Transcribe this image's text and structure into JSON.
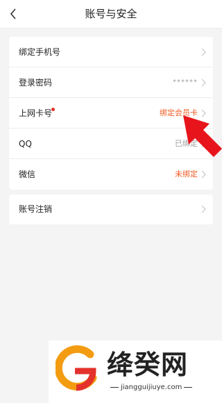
{
  "header": {
    "title": "账号与安全",
    "back_icon": "chevron-left-icon"
  },
  "settings": {
    "rows": [
      {
        "label": "绑定手机号",
        "value": "",
        "dot": false,
        "accent": false
      },
      {
        "label": "登录密码",
        "value": "******",
        "dot": false,
        "accent": false
      },
      {
        "label": "上网卡号",
        "value": "绑定会员卡",
        "dot": true,
        "accent": true
      },
      {
        "label": "QQ",
        "value": "已绑定",
        "dot": false,
        "accent": false
      },
      {
        "label": "微信",
        "value": "未绑定",
        "dot": false,
        "accent": true
      }
    ]
  },
  "account": {
    "cancel_label": "账号注销"
  },
  "annotation": {
    "arrow_icon": "red-arrow-icon",
    "arrow_color": "#e8141c"
  },
  "watermark": {
    "name": "绛癸网",
    "domain": "jiangguijiuye.com"
  },
  "colors": {
    "accent": "#f05a22",
    "notification_dot": "#e0312b",
    "background": "#f4f4f4"
  }
}
